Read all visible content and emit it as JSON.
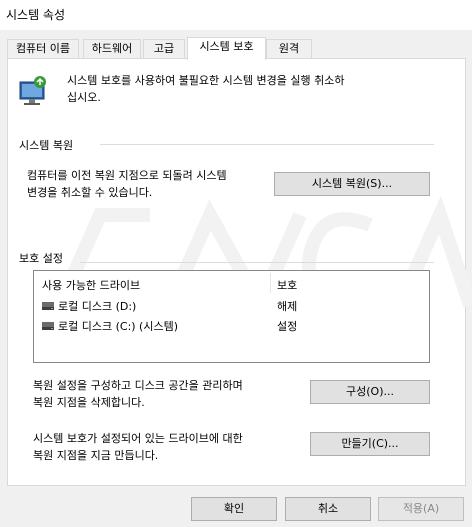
{
  "window": {
    "title": "시스템 속성"
  },
  "tabs": [
    {
      "label": "컴퓨터 이름",
      "active": false
    },
    {
      "label": "하드웨어",
      "active": false
    },
    {
      "label": "고급",
      "active": false
    },
    {
      "label": "시스템 보호",
      "active": true
    },
    {
      "label": "원격",
      "active": false
    }
  ],
  "intro": {
    "line1": "시스템 보호를 사용하여 불필요한 시스템 변경을 실행 취소하",
    "line2": "십시오."
  },
  "restore": {
    "group_label": "시스템 복원",
    "desc_line1": "컴퓨터를 이전 복원 지점으로 되돌려 시스템",
    "desc_line2": "변경을 취소할 수 있습니다.",
    "button_label": "시스템 복원(S)..."
  },
  "protection": {
    "group_label": "보호 설정",
    "columns": {
      "drive": "사용 가능한 드라이브",
      "protection": "보호"
    },
    "drives": [
      {
        "name": "로컬 디스크 (D:)",
        "status": "해제"
      },
      {
        "name": "로컬 디스크 (C:) (시스템)",
        "status": "설정"
      }
    ],
    "configure": {
      "desc_line1": "복원 설정을 구성하고 디스크 공간을 관리하며",
      "desc_line2": "복원 지점을 삭제합니다.",
      "button_label": "구성(O)..."
    },
    "create": {
      "desc_line1": "시스템 보호가 설정되어 있는 드라이브에 대한",
      "desc_line2": "복원 지점을 지금 만듭니다.",
      "button_label": "만들기(C)..."
    }
  },
  "footer": {
    "ok_label": "확인",
    "cancel_label": "취소",
    "apply_label": "적용(A)",
    "apply_enabled": false
  },
  "icons": {
    "system_protection": "computer-shield-icon",
    "drive": "hard-drive-icon"
  },
  "colors": {
    "accent": "#0078d7",
    "panel_bg": "#ffffff",
    "window_bg": "#f0f0f0",
    "button_bg": "#e1e1e1"
  }
}
